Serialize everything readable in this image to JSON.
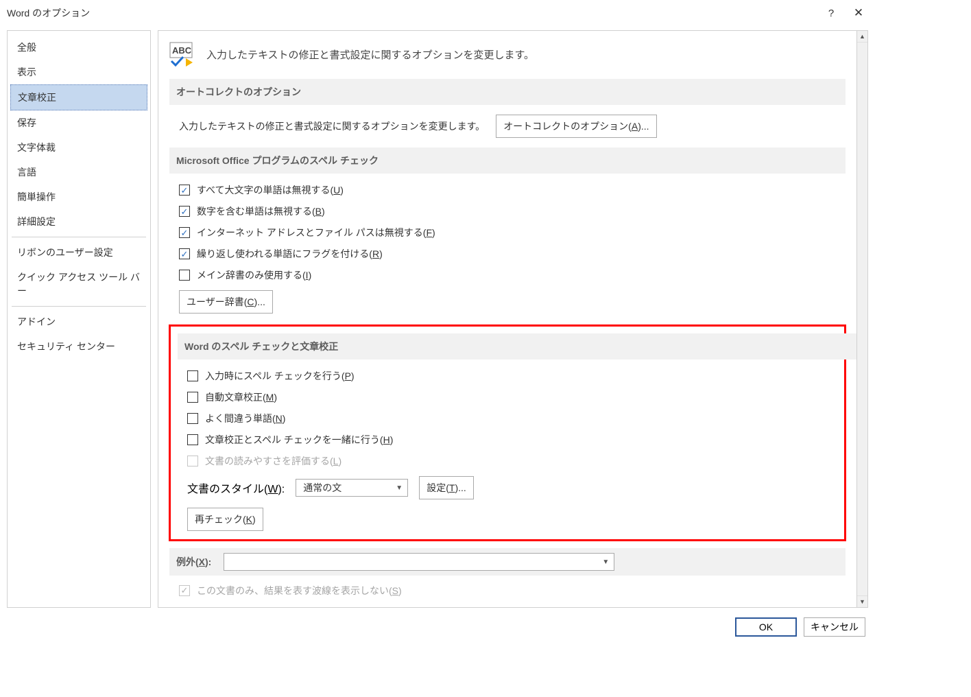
{
  "title": "Word のオプション",
  "sidebar": {
    "items": [
      "全般",
      "表示",
      "文章校正",
      "保存",
      "文字体裁",
      "言語",
      "簡単操作",
      "詳細設定",
      "リボンのユーザー設定",
      "クイック アクセス ツール バー",
      "アドイン",
      "セキュリティ センター"
    ]
  },
  "intro_text": "入力したテキストの修正と書式設定に関するオプションを変更します。",
  "section1": {
    "header": "オートコレクトのオプション",
    "desc": "入力したテキストの修正と書式設定に関するオプションを変更します。",
    "button_pre": "オートコレクトのオプション(",
    "button_u": "A",
    "button_post": ")..."
  },
  "section2": {
    "header": "Microsoft Office プログラムのスペル チェック",
    "checks": [
      {
        "pre": "すべて大文字の単語は無視する(",
        "u": "U",
        "post": ")",
        "checked": true
      },
      {
        "pre": "数字を含む単語は無視する(",
        "u": "B",
        "post": ")",
        "checked": true
      },
      {
        "pre": "インターネット アドレスとファイル パスは無視する(",
        "u": "F",
        "post": ")",
        "checked": true
      },
      {
        "pre": "繰り返し使われる単語にフラグを付ける(",
        "u": "R",
        "post": ")",
        "checked": true
      },
      {
        "pre": "メイン辞書のみ使用する(",
        "u": "I",
        "post": ")",
        "checked": false
      }
    ],
    "dict_btn_pre": "ユーザー辞書(",
    "dict_btn_u": "C",
    "dict_btn_post": ")..."
  },
  "section3": {
    "header": "Word のスペル チェックと文章校正",
    "checks": [
      {
        "pre": "入力時にスペル チェックを行う(",
        "u": "P",
        "post": ")",
        "checked": false
      },
      {
        "pre": "自動文章校正(",
        "u": "M",
        "post": ")",
        "checked": false
      },
      {
        "pre": "よく間違う単語(",
        "u": "N",
        "post": ")",
        "checked": false
      },
      {
        "pre": "文章校正とスペル チェックを一緒に行う(",
        "u": "H",
        "post": ")",
        "checked": false
      },
      {
        "pre": "文書の読みやすさを評価する(",
        "u": "L",
        "post": ")",
        "checked": false,
        "disabled": true
      }
    ],
    "style_label_pre": "文書のスタイル(",
    "style_label_u": "W",
    "style_label_post": "):",
    "style_value": "通常の文",
    "settings_btn_pre": "設定(",
    "settings_btn_u": "T",
    "settings_btn_post": ")...",
    "recheck_btn_pre": "再チェック(",
    "recheck_btn_u": "K",
    "recheck_btn_post": ")"
  },
  "exceptions": {
    "label_pre": "例外(",
    "label_u": "X",
    "label_post": "):",
    "combo_value": "",
    "check_pre": "この文書のみ、結果を表す波線を表示しない(",
    "check_u": "S",
    "check_post": ")",
    "check_checked": true
  },
  "footer": {
    "ok": "OK",
    "cancel": "キャンセル"
  }
}
